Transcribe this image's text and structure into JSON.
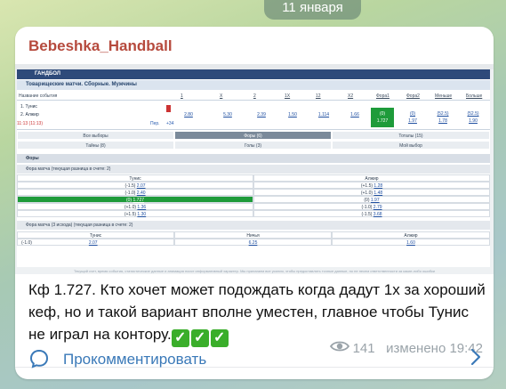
{
  "date_pill": "11 января",
  "post": {
    "channel_name": "Bebeshka_Handball",
    "message": "Кф 1.727. Кто хочет может подождать когда дадут 1х за хороший кеф, но и такой вариант вполне уместен, главное чтобы Тунис не играл на контору.",
    "checks": [
      "✓",
      "✓",
      "✓"
    ],
    "views": "141",
    "edited": "изменено 19:42",
    "comment_label": "Прокомментировать"
  },
  "screenshot": {
    "sport": "ГАНДБОЛ",
    "competition": "Товарищеские матчи. Сборные. Мужчины",
    "columns": [
      "Название события",
      "1",
      "X",
      "2",
      "1X",
      "12",
      "X2",
      "Фора1",
      "Фора2",
      "Меньше",
      "Больше"
    ],
    "event": {
      "team1": "1. Тунис",
      "team2": "2. Алжир",
      "clock": "11:13 (11:13)",
      "period": "Пер.",
      "more": "+34",
      "odds": [
        "2.80",
        "5.30",
        "2.39",
        "1.50",
        "1.114",
        "1.66"
      ],
      "fora1": [
        "(0)",
        "1.727"
      ],
      "fora2": [
        "(0)",
        "1.97"
      ],
      "under": [
        "(52.5)",
        "1.78"
      ],
      "over": [
        "(52.5)",
        "1.90"
      ]
    },
    "tabs": [
      "Все выборы",
      "Форы (6)",
      "Тоталы (15)",
      "Тайны (8)",
      "Голы (3)",
      "Мой выбор"
    ],
    "sections": {
      "fory": "Форы",
      "handicap": "Фора матча (текущая разница в счете: 2)",
      "handicap3": "Фора матча (3 исхода) (текущая разница в счете: 2)"
    },
    "team_headers": [
      "Тунис",
      "Алжир"
    ],
    "handicap_rows": [
      {
        "left": "(-1.5)",
        "left_odd": "2.07",
        "right": "(+1.5)",
        "right_odd": "1.28"
      },
      {
        "left": "(-1.0)",
        "left_odd": "2.40",
        "right": "(+1.0)",
        "right_odd": "1.48"
      },
      {
        "left": "(0)",
        "left_odd": "1.727",
        "right": "(0)",
        "right_odd": "1.97"
      },
      {
        "left": "(+1.0)",
        "left_odd": "1.36",
        "right": "(-1.0)",
        "right_odd": "2.79"
      },
      {
        "left": "(+1.5)",
        "left_odd": "1.30",
        "right": "(-1.5)",
        "right_odd": "3.68"
      }
    ],
    "h3_headers": [
      "Тунис",
      "Ничья",
      "Алжир"
    ],
    "h3_row": {
      "label": "(-1.0)",
      "v1": "2.07",
      "v2": "6.25",
      "v3": "1.60"
    },
    "footer": "Текущий счет, время события, статистические данные и анимация носят информативный характер. Мы прилагаем все усилия, чтобы предоставлять точные данные, но не несем ответственности за какие-либо ошибки"
  }
}
